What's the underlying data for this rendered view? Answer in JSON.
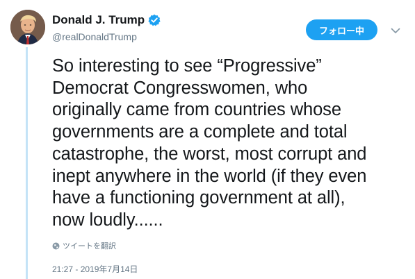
{
  "user": {
    "display_name": "Donald J. Trump",
    "handle": "@realDonaldTrump",
    "verified": true,
    "avatar_icon": "profile-photo"
  },
  "follow_button": {
    "label": "フォロー中"
  },
  "menu": {
    "icon": "chevron-down-icon"
  },
  "tweet": {
    "text": "So interesting to see “Progressive”\nDemocrat Congresswomen, who\noriginally came from countries whose\ngovernments are a complete and total\ncatastrophe, the worst, most corrupt and\ninept anywhere in the world (if they even\nhave a functioning government at all),\nnow loudly......",
    "translate_label": "ツイートを翻訳",
    "timestamp": "21:27 - 2019年7月14日"
  },
  "colors": {
    "accent": "#1da1f2",
    "secondary_text": "#657786",
    "thread_line": "#c4e3f7",
    "primary_text": "#14171a"
  }
}
